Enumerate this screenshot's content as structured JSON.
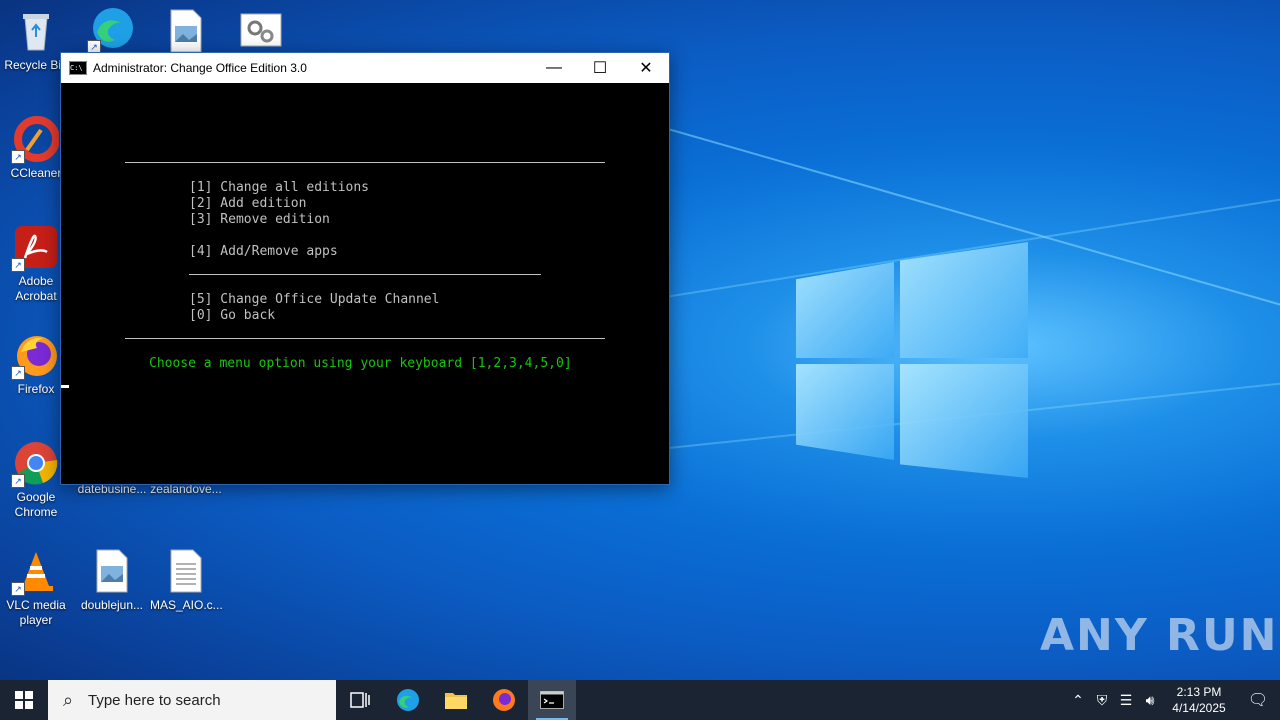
{
  "desktop": {
    "icons": [
      {
        "label": "Recycle Bin"
      },
      {
        "label": "CCleaner"
      },
      {
        "label": "Adobe Acrobat"
      },
      {
        "label": "Firefox"
      },
      {
        "label": "Google Chrome"
      },
      {
        "label": "VLC media player"
      },
      {
        "label": "datebusine..."
      },
      {
        "label": "zealandove..."
      },
      {
        "label": "doublejun..."
      },
      {
        "label": "MAS_AIO.c..."
      }
    ],
    "watermark": "ANY RUN"
  },
  "window": {
    "title": "Administrator:  Change Office Edition 3.0",
    "icon_text": "C:\\",
    "menu": [
      "[1] Change all editions",
      "[2] Add edition",
      "[3] Remove edition",
      "[4] Add/Remove apps",
      "[5] Change Office Update Channel",
      "[0] Go back"
    ],
    "prompt": "Choose a menu option using your keyboard [1,2,3,4,5,0]",
    "colors": {
      "text": "#c0c0c0",
      "prompt": "#16c60c",
      "background": "#000000"
    }
  },
  "taskbar": {
    "search_placeholder": "Type here to search",
    "time": "2:13 PM",
    "date": "4/14/2025"
  }
}
